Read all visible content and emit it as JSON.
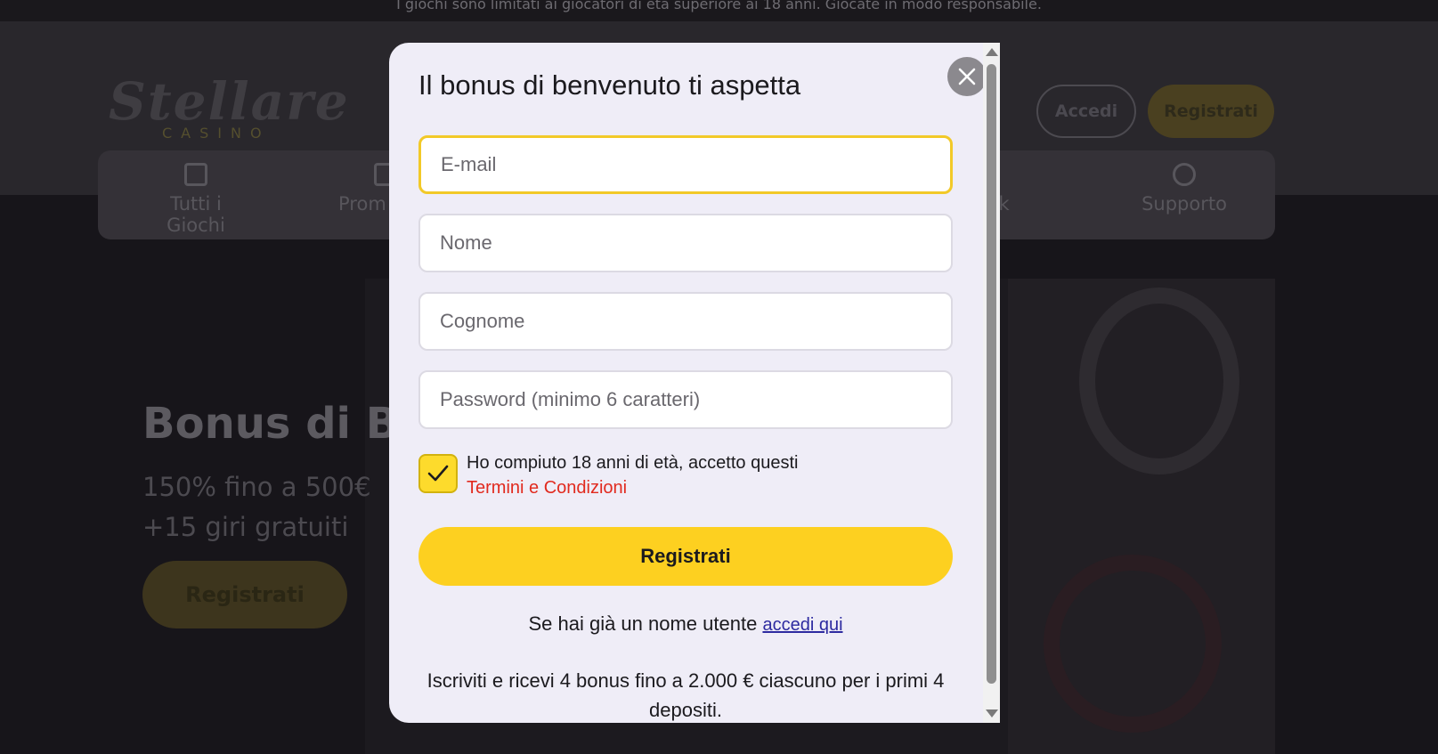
{
  "background": {
    "top_banner": "I giochi sono limitati ai giocatori di età superiore ai 18 anni. Giocate in modo responsabile.",
    "logo": {
      "main": "Stellare",
      "sub": "CASINO"
    },
    "header": {
      "login_label": "Accedi",
      "register_label": "Registrati"
    },
    "nav": [
      {
        "label": "Tutti i Giochi",
        "icon": "games-icon"
      },
      {
        "label": "Prom",
        "icon": "gift-icon"
      },
      {
        "label": "ck",
        "icon": "cashback-icon"
      },
      {
        "label": "Supporto",
        "icon": "support-icon"
      }
    ],
    "hero": {
      "title": "Bonus di Be",
      "line1": "150% fino a 500€",
      "line2": "+15 giri gratuiti",
      "button": "Registrati"
    }
  },
  "modal": {
    "title": "Il bonus di benvenuto ti aspetta",
    "fields": {
      "email_placeholder": "E-mail",
      "name_placeholder": "Nome",
      "surname_placeholder": "Cognome",
      "password_placeholder": "Password (minimo 6 caratteri)"
    },
    "consent_text": "Ho compiuto 18 anni di età, accetto questi",
    "terms_link": "Termini e Condizioni",
    "consent_checked": true,
    "submit_label": "Registrati",
    "login_prompt": "Se hai già un nome utente",
    "login_link": "accedi qui",
    "promo_text": "Iscriviti e ricevi 4 bonus fino a 2.000 € ciascuno per i primi 4 depositi."
  },
  "colors": {
    "accent_yellow": "#fdd020",
    "link_red": "#e12a1e",
    "link_blue": "#2d2aa0",
    "modal_bg": "#efedf7"
  }
}
